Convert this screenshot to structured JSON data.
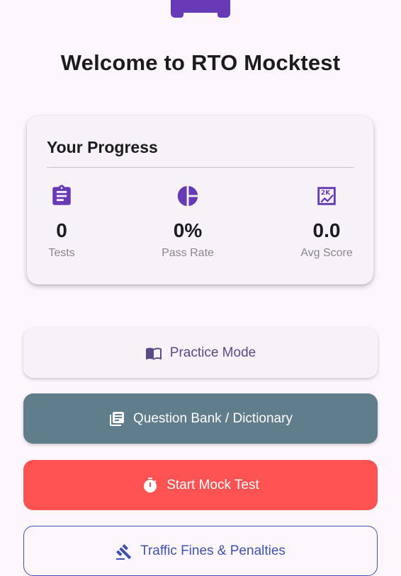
{
  "welcome_title": "Welcome to RTO Mocktest",
  "progress": {
    "title": "Your Progress",
    "stats": [
      {
        "icon": "clipboard-icon",
        "value": "0",
        "label": "Tests"
      },
      {
        "icon": "pie-chart-icon",
        "value": "0%",
        "label": "Pass Rate"
      },
      {
        "icon": "score-chart-icon",
        "value": "0.0",
        "label": "Avg Score"
      }
    ]
  },
  "buttons": {
    "practice": {
      "label": "Practice Mode",
      "icon": "book-icon"
    },
    "question_bank": {
      "label": "Question Bank / Dictionary",
      "icon": "library-books-icon"
    },
    "mock_test": {
      "label": "Start Mock Test",
      "icon": "timer-icon"
    },
    "fines": {
      "label": "Traffic Fines & Penalties",
      "icon": "gavel-icon"
    }
  },
  "colors": {
    "background": "#fdf7fd",
    "accent": "#673ab7",
    "practice_text": "#5b4a8a",
    "question_bank_bg": "#607d8b",
    "mock_test_bg": "#ff5252",
    "fines_outline": "#3f51b5"
  }
}
